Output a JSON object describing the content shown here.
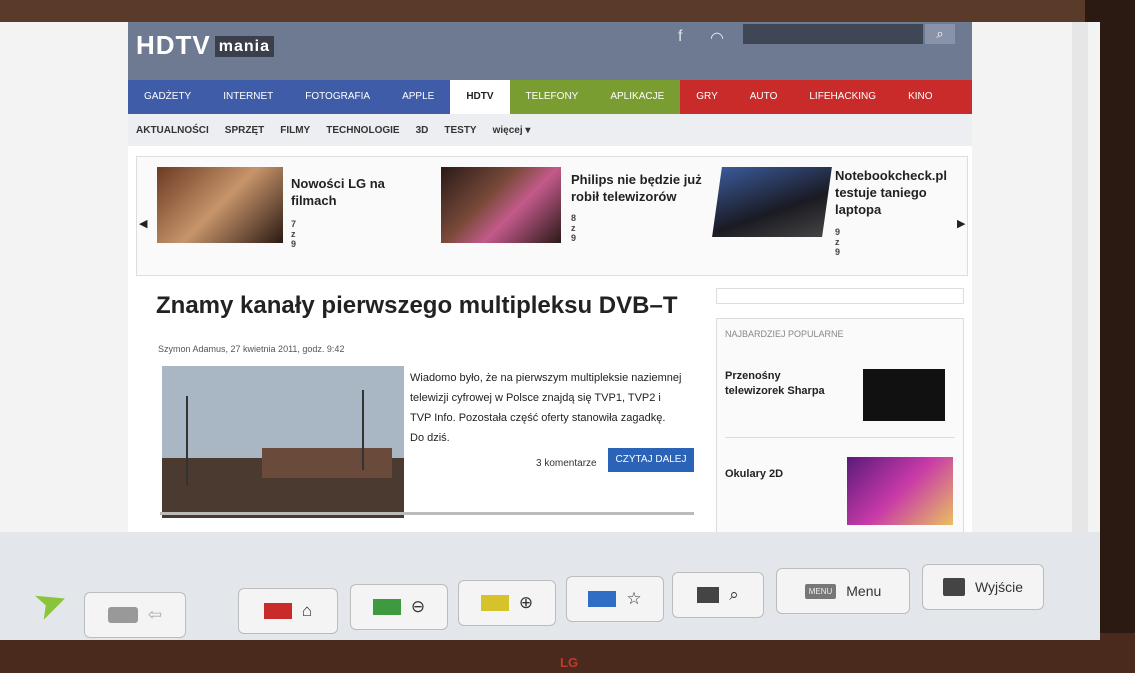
{
  "site": {
    "logo_main": "HDTV",
    "logo_sub": "mania"
  },
  "nav": [
    {
      "label": "GADŻETY",
      "color": "#3e5ca8"
    },
    {
      "label": "INTERNET",
      "color": "#3e5ca8"
    },
    {
      "label": "FOTOGRAFIA",
      "color": "#3e5ca8"
    },
    {
      "label": "APPLE",
      "color": "#3e5ca8"
    },
    {
      "label": "HDTV",
      "color": "#ffffff"
    },
    {
      "label": "TELEFONY",
      "color": "#7a9d32"
    },
    {
      "label": "APLIKACJE",
      "color": "#7a9d32"
    },
    {
      "label": "GRY",
      "color": "#c92b2b"
    },
    {
      "label": "AUTO",
      "color": "#c92b2b"
    },
    {
      "label": "LIFEHACKING",
      "color": "#c92b2b"
    },
    {
      "label": "KINO",
      "color": "#c92b2b"
    }
  ],
  "subnav": [
    "AKTUALNOŚCI",
    "SPRZĘT",
    "FILMY",
    "TECHNOLOGIE",
    "3D",
    "TESTY",
    "więcej ▾"
  ],
  "slider": [
    {
      "title_1": "Nowości LG na",
      "title_2": "filmach",
      "count": "7 z 9"
    },
    {
      "title_1": "Philips nie będzie już",
      "title_2": "robił telewizorów",
      "count": "8 z 9"
    },
    {
      "title_1": "Notebookcheck.pl",
      "title_2": "testuje taniego",
      "title_3": "laptopa",
      "count": "9 z 9"
    }
  ],
  "article": {
    "title": "Znamy kanały pierwszego multipleksu DVB–T",
    "byline": "Szymon Adamus, 27 kwietnia 2011, godz. 9:42",
    "line1": "Wiadomo było, że na pierwszym multipleksie naziemnej",
    "line2": "telewizji cyfrowej w Polsce znajdą się TVP1, TVP2 i",
    "line3": "TVP Info. Pozostała część oferty stanowiła zagadkę.",
    "line4": "Do dziś.",
    "comments": "3 komentarze",
    "read_more": "CZYTAJ DALEJ"
  },
  "popular": {
    "heading": "NAJBARDZIEJ POPULARNE",
    "item1_a": "Przenośny",
    "item1_b": "telewizorek Sharpa",
    "item2": "Okulary 2D"
  },
  "toolbar": {
    "menu_label": "Menu",
    "exit_label": "Wyjście",
    "menu_chip": "MENU"
  },
  "colors": {
    "red": "#c92b2b",
    "green": "#3e9a3e",
    "yellow": "#d6c22a",
    "blue": "#2f6ec4"
  },
  "bezel": {
    "brand": "LG"
  }
}
